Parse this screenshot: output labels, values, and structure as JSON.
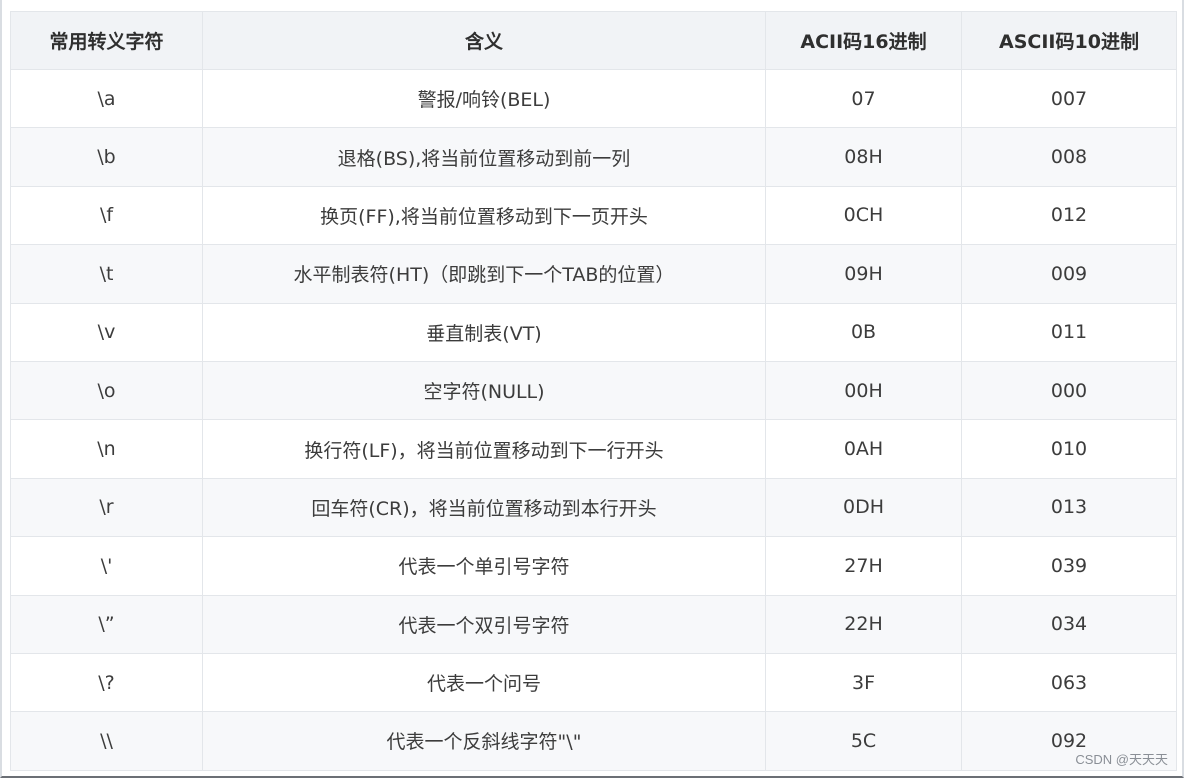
{
  "table": {
    "headers": [
      "常用转义字符",
      "含义",
      "ACII码16进制",
      "ASCII码10进制"
    ],
    "rows": [
      {
        "escape": "\\a",
        "meaning": "警报/响铃(BEL)",
        "hex": "07",
        "dec": "007"
      },
      {
        "escape": "\\b",
        "meaning": "退格(BS),将当前位置移动到前一列",
        "hex": "08H",
        "dec": "008"
      },
      {
        "escape": "\\f",
        "meaning": "换页(FF),将当前位置移动到下一页开头",
        "hex": "0CH",
        "dec": "012"
      },
      {
        "escape": "\\t",
        "meaning": "水平制表符(HT)（即跳到下一个TAB的位置）",
        "hex": "09H",
        "dec": "009"
      },
      {
        "escape": "\\v",
        "meaning": "垂直制表(VT)",
        "hex": "0B",
        "dec": "011"
      },
      {
        "escape": "\\o",
        "meaning": "空字符(NULL)",
        "hex": "00H",
        "dec": "000"
      },
      {
        "escape": "\\n",
        "meaning": "换行符(LF)，将当前位置移动到下一行开头",
        "hex": "0AH",
        "dec": "010"
      },
      {
        "escape": "\\r",
        "meaning": "回车符(CR)，将当前位置移动到本行开头",
        "hex": "0DH",
        "dec": "013"
      },
      {
        "escape": "\\'",
        "meaning": "代表一个单引号字符",
        "hex": "27H",
        "dec": "039"
      },
      {
        "escape": "\\”",
        "meaning": "代表一个双引号字符",
        "hex": "22H",
        "dec": "034"
      },
      {
        "escape": "\\?",
        "meaning": "代表一个问号",
        "hex": "3F",
        "dec": "063"
      },
      {
        "escape": "\\\\",
        "meaning": "代表一个反斜线字符\"\\\"",
        "hex": "5C",
        "dec": "092"
      }
    ]
  },
  "watermark": "CSDN @天天天"
}
